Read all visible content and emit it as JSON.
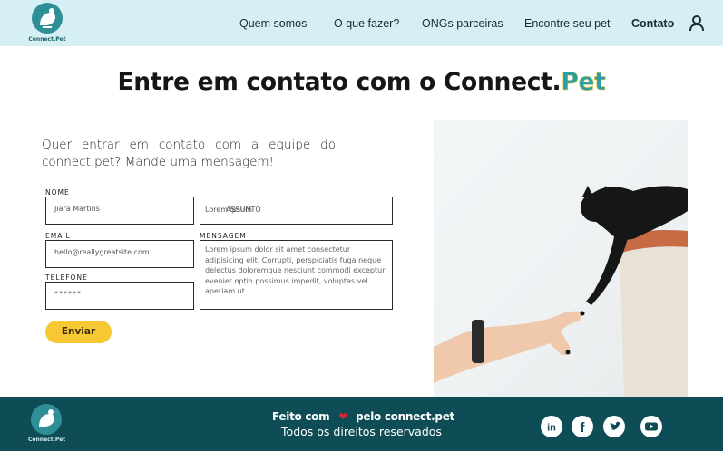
{
  "header": {
    "logo_text": "Connect.Pet",
    "nav": [
      "Quem somos",
      "O que fazer?",
      "ONGs parceiras",
      "Encontre seu pet",
      "Contato"
    ],
    "active": "Contato",
    "icons": {
      "user": "user-icon"
    }
  },
  "title": {
    "prefix": "Entre em contato com o Connect.",
    "brand": "Pet"
  },
  "intro": "Quer entrar em contato com a equipe do connect.pet? Mande uma mensagem!",
  "form": {
    "name_label": "NOME",
    "name_value": "Jiara Martins",
    "subject_value": "Lorem ipsum",
    "subject_placeholder": "ASSUNTO",
    "email_label": "EMAIL",
    "email_value": "hello@reallygreatsite.com",
    "message_label": "MENSAGEM",
    "message_value": "Lorem ipsum dolor sit amet consectetur adipisicing elit. Corrupti, perspiciatis fuga neque delectus doloremque nesciunt commodi excepturi eveniet optio possimus impedit, voluptas vel aperiam ut.",
    "phone_label": "TELEFONE",
    "phone_value": "******",
    "submit_label": "Enviar"
  },
  "footer": {
    "logo_text": "Connect.Pet",
    "made_prefix": "Feito com",
    "made_suffix": "pelo connect.pet",
    "rights": "Todos os direitos reservados",
    "social_icons": [
      "linkedin-icon",
      "facebook-icon",
      "twitter-icon",
      "youtube-icon"
    ]
  },
  "colors": {
    "header_bg": "#d6eff5",
    "footer_bg": "#0e4d56",
    "brand_teal": "#2a9fa5",
    "button": "#f6c833",
    "heart": "#e02333"
  }
}
